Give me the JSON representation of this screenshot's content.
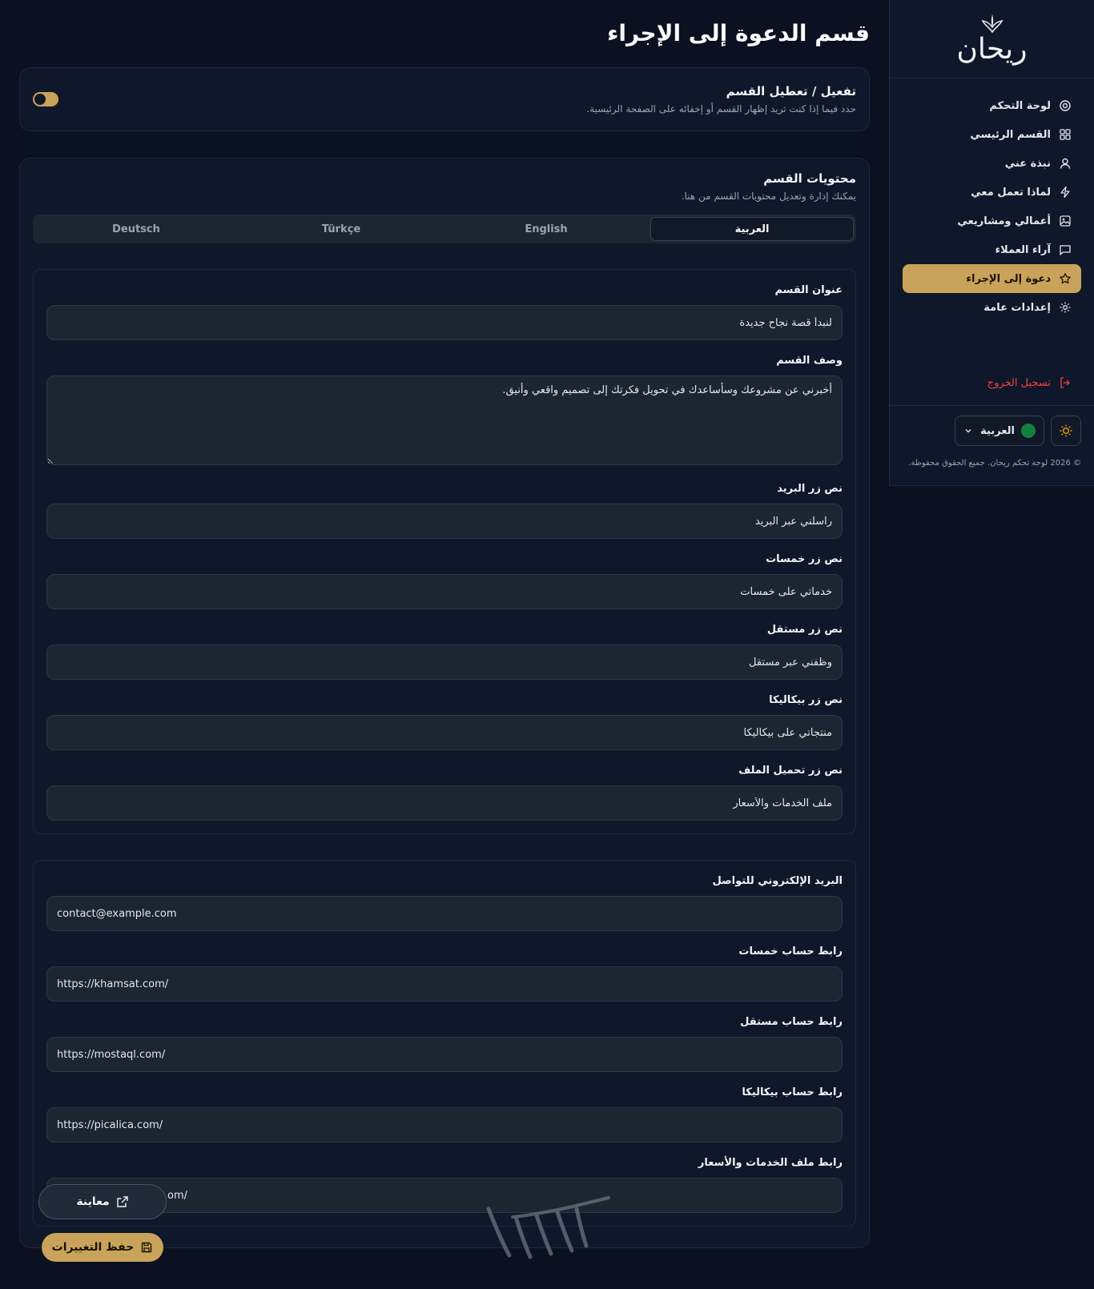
{
  "brand": {
    "name": "ريحان"
  },
  "sidebar": {
    "items": [
      {
        "label": "لوحة التحكم",
        "icon": "dashboard-icon"
      },
      {
        "label": "القسم الرئيسي",
        "icon": "grid-icon"
      },
      {
        "label": "نبذة عني",
        "icon": "user-icon"
      },
      {
        "label": "لماذا تعمل معي",
        "icon": "bolt-icon"
      },
      {
        "label": "أعمالي ومشاريعي",
        "icon": "image-icon"
      },
      {
        "label": "آراء العملاء",
        "icon": "message-icon"
      },
      {
        "label": "دعوة إلى الإجراء",
        "icon": "star-icon",
        "active": true
      },
      {
        "label": "إعدادات عامة",
        "icon": "gear-icon"
      }
    ],
    "logout": "تسجيل الخروج",
    "language": "العربية",
    "copyright": "© 2026 لوحة تحكم ريحان. جميع الحقوق محفوظة."
  },
  "page": {
    "title": "قسم الدعوة إلى الإجراء",
    "toggle": {
      "title": "تفعيل / تعطيل القسم",
      "subtitle": "حدد فيما إذا كنت تريد إظهار القسم أو إخفائه على الصفحة الرئيسية.",
      "enabled": true
    },
    "content": {
      "title": "محتويات القسم",
      "subtitle": "يمكنك إدارة وتعديل محتويات القسم من هنا.",
      "tabs": [
        "العربية",
        "English",
        "Türkçe",
        "Deutsch"
      ],
      "active_tab": "العربية",
      "fields": {
        "section_title": {
          "label": "عنوان القسم",
          "value": "لنبدأ قصة نجاح جديدة"
        },
        "section_desc": {
          "label": "وصف القسم",
          "value": "أخبرني عن مشروعك وسأساعدك في تحويل فكرتك إلى تصميم واقعي وأنيق."
        },
        "email_btn": {
          "label": "نص زر البريد",
          "value": "راسلني عبر البريد"
        },
        "khamsat_btn": {
          "label": "نص زر خمسات",
          "value": "خدماتي على خمسات"
        },
        "mostaql_btn": {
          "label": "نص زر مستقل",
          "value": "وظفني عبر مستقل"
        },
        "picalica_btn": {
          "label": "نص زر بيكاليكا",
          "value": "منتجاتي على بيكاليكا"
        },
        "file_btn": {
          "label": "نص زر تحميل الملف",
          "value": "ملف الخدمات والأسعار"
        }
      },
      "links": {
        "email": {
          "label": "البريد الإلكتروني للتواصل",
          "value": "contact@example.com"
        },
        "khamsat": {
          "label": "رابط حساب خمسات",
          "value": "https://khamsat.com/"
        },
        "mostaql": {
          "label": "رابط حساب مستقل",
          "value": "https://mostaql.com/"
        },
        "picalica": {
          "label": "رابط حساب بيكاليكا",
          "value": "https://picalica.com/"
        },
        "file": {
          "label": "رابط ملف الخدمات والأسعار",
          "value": "om/"
        }
      }
    }
  },
  "actions": {
    "preview": "معاينة",
    "save": "حفظ التغييرات"
  },
  "colors": {
    "accent": "#c9a35a",
    "background": "#0b1120",
    "danger": "#ef4444"
  }
}
